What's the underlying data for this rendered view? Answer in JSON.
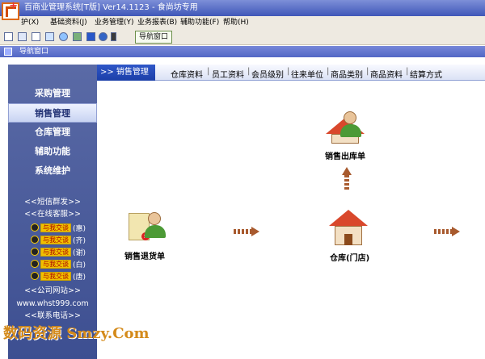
{
  "window": {
    "title": "百商业管理系统[T版] Ver14.1123  -  食尚坊专用"
  },
  "menubar": [
    "护(X)",
    "基础资料(J)",
    "业务管理(Y)",
    "业务报表(B)",
    "辅助功能(F)",
    "帮助(H)"
  ],
  "toolbar": {
    "nav_button": "导航窗口"
  },
  "nav_window": {
    "title": "导航窗口"
  },
  "sidebar": {
    "items": [
      "采购管理",
      "销售管理",
      "仓库管理",
      "辅助功能",
      "系统维护"
    ],
    "active": 1,
    "sms": "<<短信群发>>",
    "service": "<<在线客服>>",
    "qq_badge": "与我交谈",
    "agents": [
      "(惠)",
      "(齐)",
      "(谢)",
      "(白)",
      "(唐)"
    ],
    "site_label": "<<公司网站>>",
    "site": "www.whst999.com",
    "phone_label": "<<联系电话>>"
  },
  "content": {
    "crumb": ">> 销售管理",
    "links": [
      "仓库资料",
      "员工资料",
      "会员级别",
      "往来单位",
      "商品类别",
      "商品资料",
      "结算方式"
    ],
    "separator": "|"
  },
  "flow": {
    "nodes": {
      "sales_out": "销售出库单",
      "sales_return": "销售退货单",
      "warehouse": "仓库(门店)"
    }
  },
  "watermark": "数码资源 Smzy.Com",
  "colors": {
    "sidebar": "#4a5b9c",
    "crumb": "#2447b8",
    "arrow": "#a85a2e",
    "roof": "#d9482c"
  }
}
